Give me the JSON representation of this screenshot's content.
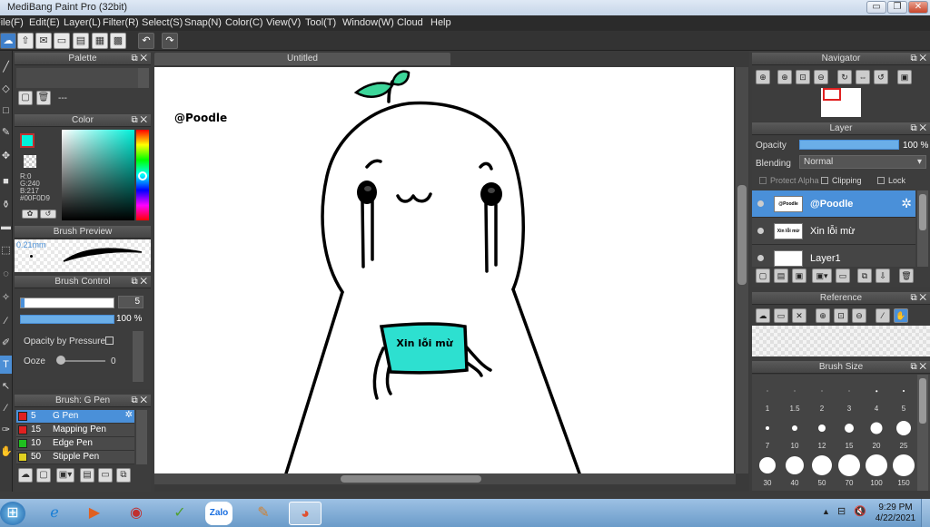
{
  "app": {
    "title": "MediBang Paint Pro (32bit)"
  },
  "window_controls": {
    "minimize": "▭",
    "maximize": "❐",
    "close": "✕"
  },
  "menu": [
    "File(F)",
    "Edit(E)",
    "Layer(L)",
    "Filter(R)",
    "Select(S)",
    "Snap(N)",
    "Color(C)",
    "View(V)",
    "Tool(T)",
    "Window(W)",
    "Cloud",
    "Help"
  ],
  "document": {
    "tab_title": "Untitled"
  },
  "palette": {
    "title": "Palette",
    "entry": "---"
  },
  "color": {
    "title": "Color",
    "r": "R:0",
    "g": "G:240",
    "b": "B:217",
    "hex": "#00F0D9",
    "accent": "#00f0d9"
  },
  "brush_preview": {
    "title": "Brush Preview",
    "size": "0.21mm"
  },
  "brush_control": {
    "title": "Brush Control",
    "size_value": "5",
    "opacity_value": "100 %",
    "opacity_by_pressure": "Opacity by Pressure",
    "ooze_label": "Ooze",
    "ooze_value": "0"
  },
  "brush_list": {
    "title": "Brush: G Pen",
    "items": [
      {
        "size": "5",
        "name": "G Pen",
        "color": "#e02020"
      },
      {
        "size": "15",
        "name": "Mapping Pen",
        "color": "#e02020"
      },
      {
        "size": "10",
        "name": "Edge Pen",
        "color": "#20c020"
      },
      {
        "size": "50",
        "name": "Stipple Pen",
        "color": "#e0d020"
      }
    ]
  },
  "navigator": {
    "title": "Navigator"
  },
  "layer": {
    "title": "Layer",
    "opacity_label": "Opacity",
    "opacity_value": "100 %",
    "blending_label": "Blending",
    "blending_value": "Normal",
    "protect_alpha": "Protect Alpha",
    "clipping": "Clipping",
    "lock": "Lock",
    "layers": [
      {
        "name": "@Poodle",
        "thumb_text": "@Poodle"
      },
      {
        "name": "Xin lỗi mừ",
        "thumb_text": "Xin lỗi mừ"
      },
      {
        "name": "Layer1",
        "thumb_text": ""
      }
    ]
  },
  "reference": {
    "title": "Reference"
  },
  "brush_size": {
    "title": "Brush Size",
    "sizes": [
      "1",
      "1.5",
      "2",
      "3",
      "4",
      "5",
      "7",
      "10",
      "12",
      "15",
      "20",
      "25",
      "30",
      "40",
      "50",
      "70",
      "100",
      "150"
    ]
  },
  "drawing": {
    "signature": "@Poodle",
    "sign_text": "Xin lỗi mừ",
    "sign_color": "#2de0d0",
    "leaf_color": "#3dd69a"
  },
  "taskbar": {
    "time": "9:29 PM",
    "date": "4/22/2021",
    "zalo": "Zalo"
  }
}
